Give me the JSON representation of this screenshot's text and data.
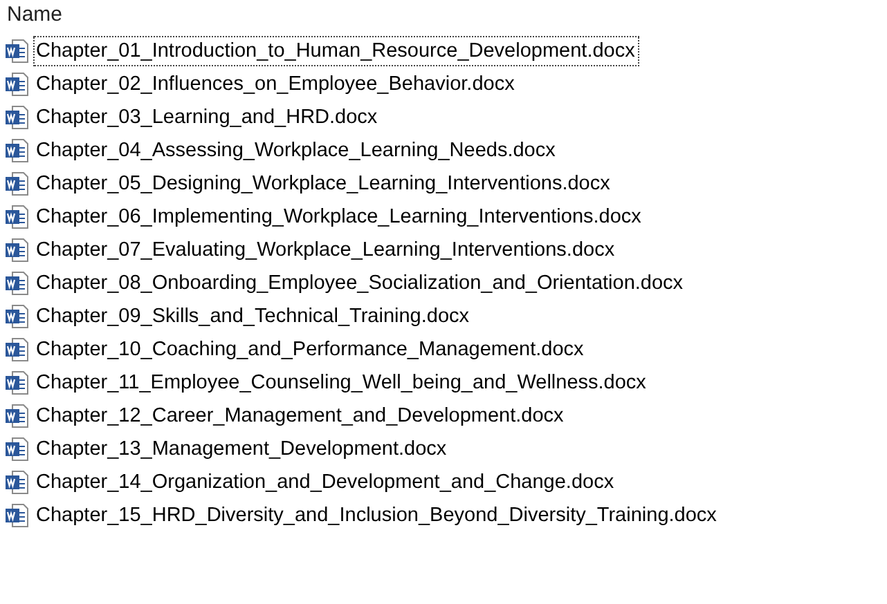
{
  "column_header": "Name",
  "files": [
    {
      "name": "Chapter_01_Introduction_to_Human_Resource_Development.docx",
      "focused": true
    },
    {
      "name": "Chapter_02_Influences_on_Employee_Behavior.docx",
      "focused": false
    },
    {
      "name": "Chapter_03_Learning_and_HRD.docx",
      "focused": false
    },
    {
      "name": "Chapter_04_Assessing_Workplace_Learning_Needs.docx",
      "focused": false
    },
    {
      "name": "Chapter_05_Designing_Workplace_Learning_Interventions.docx",
      "focused": false
    },
    {
      "name": "Chapter_06_Implementing_Workplace_Learning_Interventions.docx",
      "focused": false
    },
    {
      "name": "Chapter_07_Evaluating_Workplace_Learning_Interventions.docx",
      "focused": false
    },
    {
      "name": "Chapter_08_Onboarding_Employee_Socialization_and_Orientation.docx",
      "focused": false
    },
    {
      "name": "Chapter_09_Skills_and_Technical_Training.docx",
      "focused": false
    },
    {
      "name": "Chapter_10_Coaching_and_Performance_Management.docx",
      "focused": false
    },
    {
      "name": "Chapter_11_Employee_Counseling_Well_being_and_Wellness.docx",
      "focused": false
    },
    {
      "name": "Chapter_12_Career_Management_and_Development.docx",
      "focused": false
    },
    {
      "name": "Chapter_13_Management_Development.docx",
      "focused": false
    },
    {
      "name": "Chapter_14_Organization_and_Development_and_Change.docx",
      "focused": false
    },
    {
      "name": "Chapter_15_HRD_Diversity_and_Inclusion_Beyond_Diversity_Training.docx",
      "focused": false
    }
  ]
}
